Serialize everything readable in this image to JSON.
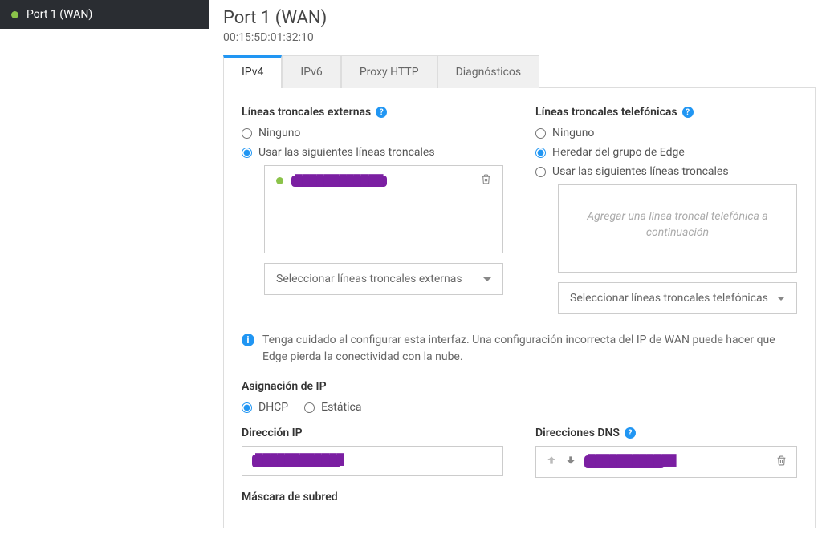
{
  "sidebar": {
    "items": [
      {
        "label": "Port 1 (WAN)"
      }
    ]
  },
  "header": {
    "title": "Port 1 (WAN)",
    "mac": "00:15:5D:01:32:10"
  },
  "tabs": [
    {
      "label": "IPv4",
      "active": true
    },
    {
      "label": "IPv6"
    },
    {
      "label": "Proxy HTTP"
    },
    {
      "label": "Diagnósticos"
    }
  ],
  "externalTrunks": {
    "label": "Líneas troncales externas",
    "options": {
      "none": "Ninguno",
      "use": "Usar las siguientes líneas troncales"
    },
    "selectPlaceholder": "Seleccionar líneas troncales externas",
    "item": "████████████"
  },
  "phoneTrunks": {
    "label": "Líneas troncales telefónicas",
    "options": {
      "none": "Ninguno",
      "inherit": "Heredar del grupo de Edge",
      "use": "Usar las siguientes líneas troncales"
    },
    "placeholder": "Agregar una línea troncal telefónica a continuación",
    "selectPlaceholder": "Seleccionar líneas troncales telefónicas"
  },
  "warning": "Tenga cuidado al configurar esta interfaz. Una configuración incorrecta del IP de WAN puede hacer que Edge pierda la conectividad con la nube.",
  "ipAssignment": {
    "label": "Asignación de IP",
    "dhcp": "DHCP",
    "static": "Estática"
  },
  "ipAddress": {
    "label": "Dirección IP",
    "value": "████████████"
  },
  "dns": {
    "label": "Direcciones DNS",
    "value": "████████████"
  },
  "subnet": {
    "label": "Máscara de subred"
  }
}
